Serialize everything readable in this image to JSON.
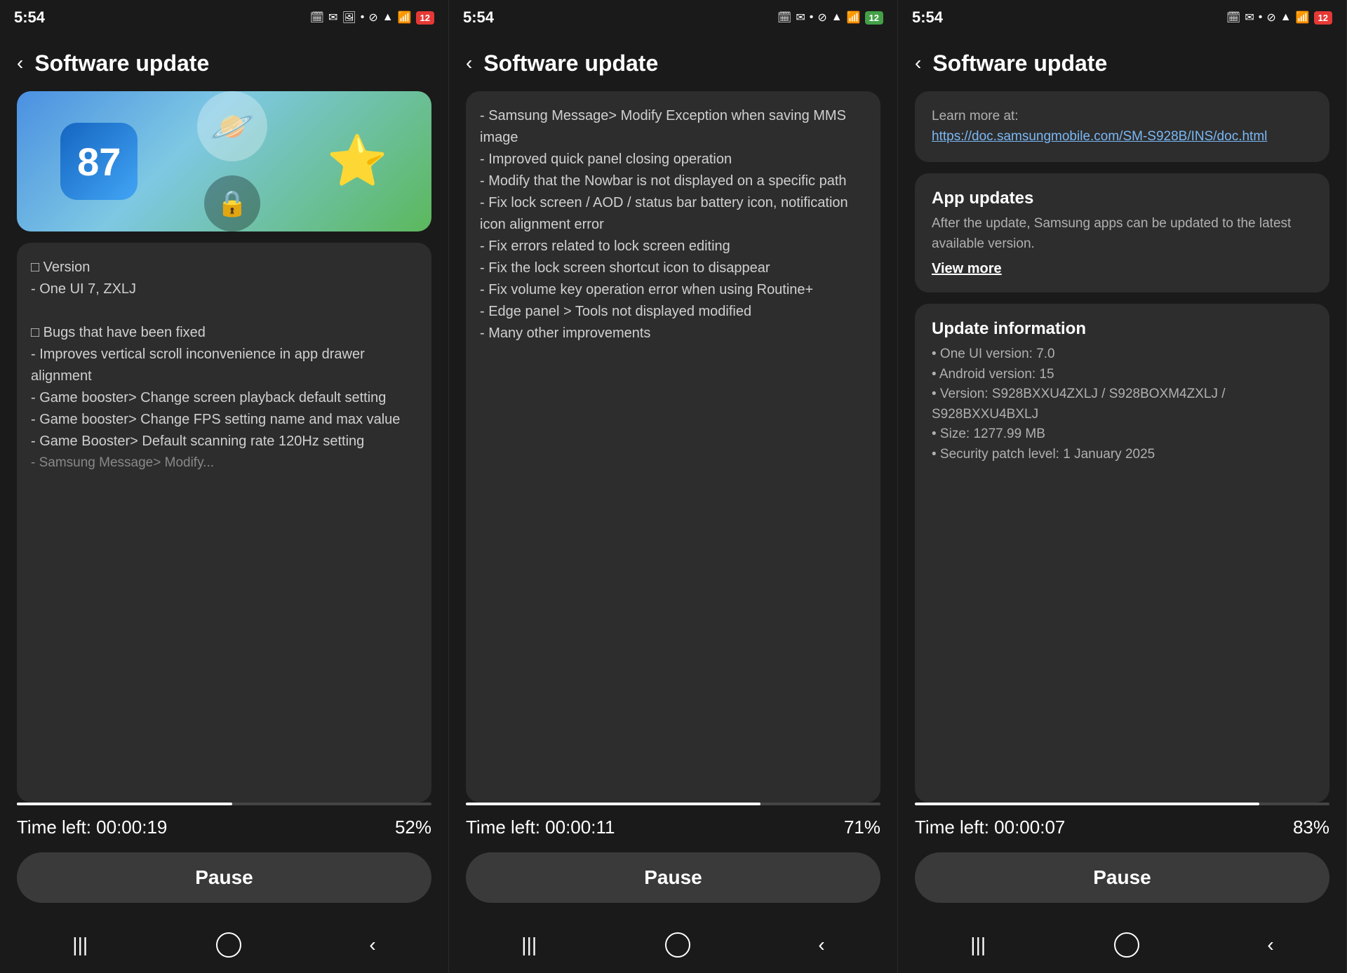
{
  "panels": [
    {
      "id": "panel1",
      "status_time": "5:54",
      "battery_color": "red",
      "battery_number": "12",
      "page_title": "Software update",
      "back_label": "‹",
      "has_image": true,
      "content_type": "changelog_start",
      "content_lines": [
        "□ Version",
        "- One UI 7, ZXLJ",
        "",
        "□ Bugs that have been fixed",
        "- Improves vertical scroll inconvenience in app drawer alignment",
        "- Game booster> Change screen playback default setting",
        "- Game booster> Change FPS setting name and max value",
        "- Game Booster> Default scanning rate 120Hz setting",
        "- Samsung Message> Modify..."
      ],
      "progress_percent": 52,
      "time_left": "Time left: 00:00:19",
      "percent_label": "52%",
      "pause_label": "Pause",
      "nav": [
        "|||",
        "○",
        "‹"
      ]
    },
    {
      "id": "panel2",
      "status_time": "5:54",
      "battery_color": "green",
      "battery_number": "12",
      "page_title": "Software update",
      "back_label": "‹",
      "has_image": false,
      "content_type": "changelog_mid",
      "content_lines": [
        "- Samsung Message> Modify Exception when saving MMS image",
        "- Improved quick panel closing operation",
        "- Modify that the Nowbar is not displayed on a specific path",
        "- Fix lock screen / AOD / status bar battery icon, notification icon alignment error",
        "- Fix errors related to lock screen editing",
        "- Fix the lock screen shortcut icon to disappear",
        "- Fix volume key operation error when using Routine+",
        "- Edge panel > Tools not displayed modified",
        "- Many other improvements"
      ],
      "progress_percent": 71,
      "time_left": "Time left: 00:00:11",
      "percent_label": "71%",
      "pause_label": "Pause",
      "nav": [
        "|||",
        "○",
        "‹"
      ]
    },
    {
      "id": "panel3",
      "status_time": "5:54",
      "battery_color": "red",
      "battery_number": "12",
      "page_title": "Software update",
      "back_label": "‹",
      "has_image": false,
      "content_type": "info",
      "learn_more_label": "Learn more at:",
      "learn_more_url": "https://doc.samsungmobile.com/SM-S928B/INS/doc.html",
      "app_updates_title": "App updates",
      "app_updates_text": "After the update, Samsung apps can be updated to the latest available version.",
      "view_more_label": "View more",
      "update_info_title": "Update information",
      "update_info_items": [
        "• One UI version: 7.0",
        "• Android version: 15",
        "• Version: S928BXXU4ZXLJ / S928BOXM4ZXLJ / S928BXXU4BXLJ",
        "• Size: 1277.99 MB",
        "• Security patch level: 1 January 2025"
      ],
      "progress_percent": 83,
      "time_left": "Time left: 00:00:07",
      "percent_label": "83%",
      "pause_label": "Pause",
      "nav": [
        "|||",
        "○",
        "‹"
      ]
    }
  ]
}
